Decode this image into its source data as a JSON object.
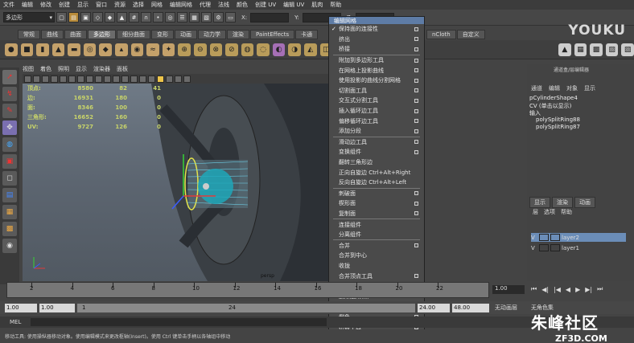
{
  "menubar": [
    "文件",
    "编辑",
    "修改",
    "创建",
    "显示",
    "窗口",
    "资源",
    "选择",
    "网格",
    "编辑网格",
    "代理",
    "法线",
    "颜色",
    "创建 UV",
    "编辑 UV",
    "肌肉",
    "帮助"
  ],
  "status": {
    "mode": "多边形",
    "x_label": "X:",
    "y_label": "Y:",
    "z_label": "Z:"
  },
  "shelf_tabs": [
    "常规",
    "曲线",
    "曲面",
    "多边形",
    "细分曲面",
    "变形",
    "动画",
    "动力学",
    "渲染",
    "PaintEffects",
    "卡通"
  ],
  "shelf_tabs_right": [
    "nCloth",
    "自定义"
  ],
  "shelf_active": "多边形",
  "watermark": {
    "en": "YOUKU",
    "cn": "优酷"
  },
  "panel_menu": [
    "视图",
    "着色",
    "照明",
    "显示",
    "渲染器",
    "面板"
  ],
  "hud": {
    "rows": [
      {
        "label": "顶点:",
        "a": "8580",
        "b": "82",
        "c": "41"
      },
      {
        "label": "边:",
        "a": "16931",
        "b": "180",
        "c": "0"
      },
      {
        "label": "面:",
        "a": "8346",
        "b": "100",
        "c": "0"
      },
      {
        "label": "三角形:",
        "a": "16652",
        "b": "160",
        "c": "0"
      },
      {
        "label": "UV:",
        "a": "9727",
        "b": "126",
        "c": "0"
      }
    ]
  },
  "viewport_label": "persp",
  "marking_menu": {
    "title": "编辑网格",
    "items": [
      {
        "label": "保持面的连接性",
        "check": true,
        "box": true
      },
      {
        "label": "挤出",
        "box": true
      },
      {
        "label": "桥接",
        "box": true
      },
      {
        "label": "附加到多边形工具",
        "box": true
      },
      {
        "label": "在网格上投影曲线",
        "box": true
      },
      {
        "label": "使用投影的曲线分割网格",
        "box": true
      },
      {
        "label": "切割面工具",
        "box": true
      },
      {
        "label": "交互式分割工具",
        "box": true
      },
      {
        "label": "插入循环边工具",
        "box": true
      },
      {
        "label": "偏移循环边工具",
        "box": true
      },
      {
        "label": "添加分段",
        "box": true
      },
      {
        "label": "滑动边工具",
        "box": true
      },
      {
        "label": "变换组件",
        "box": true
      },
      {
        "label": "翻转三角形边",
        "box": false
      },
      {
        "label": "正向自旋边 Ctrl+Alt+Right",
        "box": false
      },
      {
        "label": "反向自旋边 Ctrl+Alt+Left",
        "box": false
      },
      {
        "label": "刺破面",
        "box": true
      },
      {
        "label": "楔形面",
        "box": true
      },
      {
        "label": "复制面",
        "box": true
      },
      {
        "label": "连接组件",
        "box": false
      },
      {
        "label": "分离组件",
        "box": false
      },
      {
        "label": "合并",
        "box": true
      },
      {
        "label": "合并到中心",
        "box": false
      },
      {
        "label": "收拢",
        "box": false
      },
      {
        "label": "合并顶点工具",
        "box": true
      },
      {
        "label": "合并边工具",
        "box": true
      },
      {
        "label": "删除边/顶点",
        "box": false
      },
      {
        "label": "切角顶点",
        "box": true
      },
      {
        "label": "倒角",
        "box": true
      },
      {
        "label": "折痕工具",
        "box": true
      },
      {
        "label": "移除选定对象",
        "box": false
      }
    ]
  },
  "channel_box": {
    "title": "通道盒/层编辑器",
    "tabs": [
      "通道",
      "编辑",
      "对象",
      "显示"
    ],
    "object": "pCylinderShape4",
    "cv_hint": "CV (单击以显示)",
    "inputs_label": "输入",
    "inputs": [
      "polySplitRing88",
      "polySplitRing87"
    ]
  },
  "layer_editor": {
    "tabs": [
      "显示",
      "渲染",
      "动画"
    ],
    "menu": [
      "层",
      "选项",
      "帮助"
    ],
    "layers": [
      {
        "v": "V",
        "name": "layer2",
        "selected": true
      },
      {
        "v": "V",
        "name": "layer1",
        "selected": false
      }
    ]
  },
  "timeline": {
    "ticks": [
      "2",
      "4",
      "6",
      "8",
      "10",
      "12",
      "14",
      "16",
      "18",
      "20",
      "22"
    ],
    "current": "1.00"
  },
  "range": {
    "start": "1.00",
    "start2": "1.00",
    "marker": "1",
    "end_marker": "24",
    "end": "24.00",
    "end2": "48.00",
    "anim_layer": "无动画层",
    "char_set": "无角色集"
  },
  "mel": {
    "label": "MEL"
  },
  "help_text": "移动工具: 使用操纵器移动对象。使用编辑模式来更改枢轴(Insert)。使用 Ctrl 键单击手柄以各轴组中移动",
  "site_watermark": {
    "name": "朱峰社区",
    "url": "ZF3D.COM"
  },
  "colors": {
    "accent": "#5e7ca6",
    "hud": "#c8d46a",
    "selection_layer": "#6b8db8"
  }
}
